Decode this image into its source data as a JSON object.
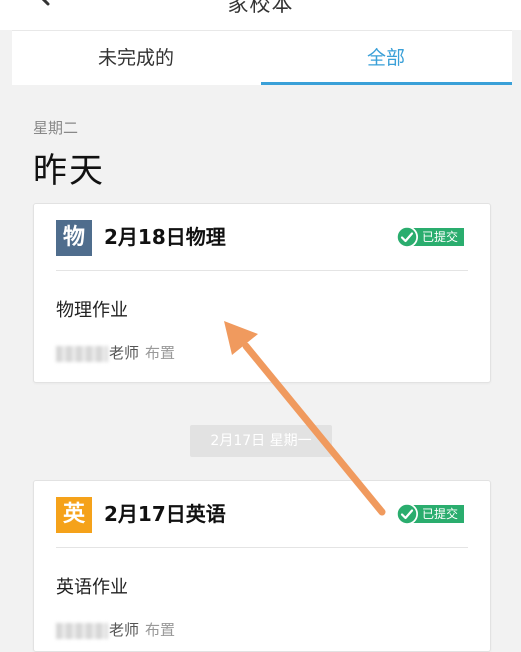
{
  "header": {
    "title": "家校本"
  },
  "tabs": [
    {
      "label": "未完成的",
      "active": false
    },
    {
      "label": "全部",
      "active": true
    }
  ],
  "section": {
    "weekday": "星期二",
    "day_label": "昨天"
  },
  "cards": [
    {
      "badge": "物",
      "badge_color": "#4f6d8d",
      "title": "2月18日物理",
      "status": "已提交",
      "body": "物理作业",
      "teacher": "老师",
      "assigned": "布置"
    },
    {
      "badge": "英",
      "badge_color": "#f5a21a",
      "title": "2月17日英语",
      "status": "已提交",
      "body": "英语作业",
      "teacher": "老师",
      "assigned": "布置"
    }
  ],
  "date_separator": "2月17日 星期一",
  "colors": {
    "accent": "#3aa0d8",
    "status_green": "#2aad6e",
    "arrow": "#f09a5e"
  },
  "icons": {
    "back": "chevron-left-icon",
    "status": "check-circle-icon"
  }
}
